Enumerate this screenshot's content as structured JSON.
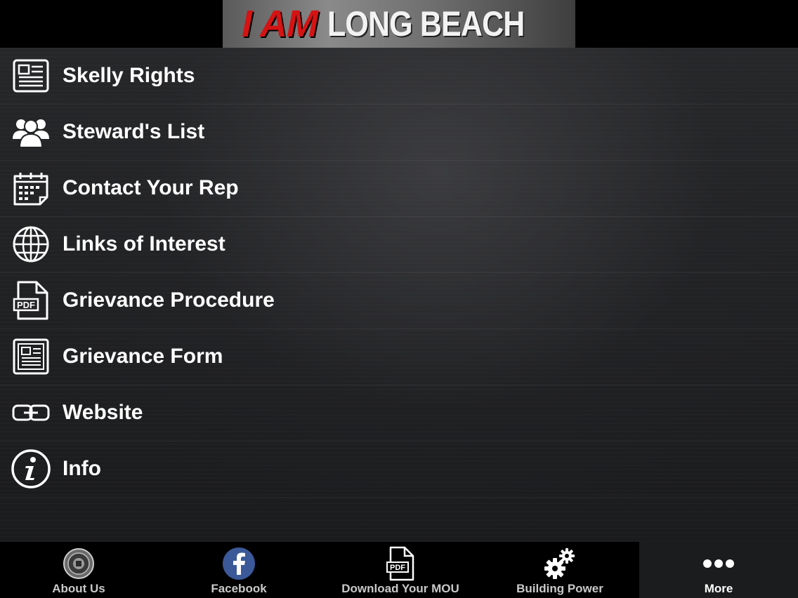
{
  "header": {
    "logo_part1": "I AM",
    "logo_part2": "LONG BEACH"
  },
  "menu": {
    "items": [
      {
        "label": "Skelly Rights",
        "icon": "newspaper-icon"
      },
      {
        "label": "Steward's List",
        "icon": "users-icon"
      },
      {
        "label": "Contact Your Rep",
        "icon": "calendar-icon"
      },
      {
        "label": "Links of Interest",
        "icon": "globe-icon"
      },
      {
        "label": "Grievance Procedure",
        "icon": "pdf-icon"
      },
      {
        "label": "Grievance Form",
        "icon": "document-icon"
      },
      {
        "label": "Website",
        "icon": "link-icon"
      },
      {
        "label": "Info",
        "icon": "info-icon"
      }
    ]
  },
  "tabbar": {
    "tabs": [
      {
        "label": "About Us",
        "icon": "emblem-icon"
      },
      {
        "label": "Facebook",
        "icon": "facebook-icon"
      },
      {
        "label": "Download Your MOU",
        "icon": "pdf-icon"
      },
      {
        "label": "Building Power",
        "icon": "gears-icon"
      },
      {
        "label": "More",
        "icon": "more-icon",
        "active": true
      }
    ]
  },
  "colors": {
    "logo_red": "#d41414",
    "background": "#000000",
    "menu_bg": "#232426",
    "text": "#ffffff",
    "tab_label": "#c9c9c9",
    "facebook_blue": "#3b5998"
  }
}
